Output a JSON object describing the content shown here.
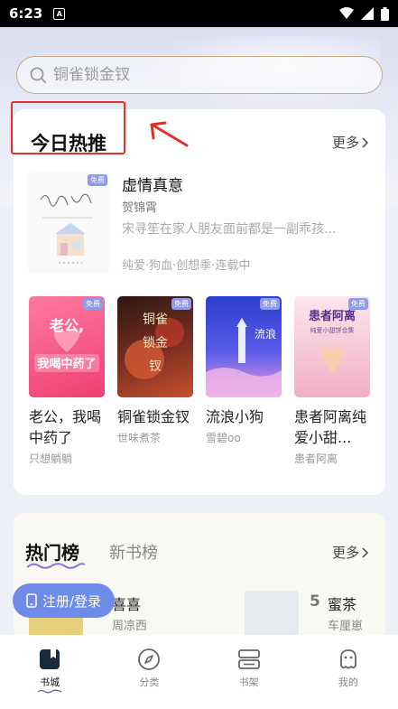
{
  "status_bar": {
    "time": "6:23",
    "notification_icon": "A"
  },
  "search": {
    "placeholder": "铜雀锁金钗"
  },
  "recommend": {
    "title": "今日热推",
    "more_label": "更多",
    "featured": {
      "badge": "免费",
      "title": "虚情真意",
      "author": "贺锦霄",
      "description": "宋寻笙在家人朋友面前都是一副乖孩...",
      "tags": "纯爱·狗血·创想季·连载中"
    },
    "books": [
      {
        "title": "老公，我喝中药了",
        "author": "只想躺躺",
        "badge": "免费",
        "cover_text": "老公，我喝中药了",
        "cover_color": "#f25a86"
      },
      {
        "title": "铜雀锁金钗",
        "author": "世味煮茶",
        "badge": "免费",
        "cover_text": "铜雀锁金钗",
        "cover_color": "#4a2a22"
      },
      {
        "title": "流浪小狗",
        "author": "雪碧oo",
        "badge": "免费",
        "cover_text": "流浪小狗",
        "cover_color": "#3b4fd6"
      },
      {
        "title": "患者阿离纯爱小甜...",
        "author": "患者阿离",
        "badge": "免费",
        "cover_text": "患者阿离",
        "cover_color": "#f4c6d2"
      }
    ]
  },
  "ranking": {
    "tab_hot": "热门榜",
    "tab_new": "新书榜",
    "more_label": "更多",
    "items": [
      {
        "title": "喜喜",
        "author": "周凉西"
      },
      {
        "rank": "5",
        "title": "蜜茶",
        "author": "车厘崽"
      }
    ]
  },
  "register_button": "注册/登录",
  "bottom_nav": [
    {
      "label": "书城",
      "icon": "bookstore-icon",
      "active": true
    },
    {
      "label": "分类",
      "icon": "compass-icon",
      "active": false
    },
    {
      "label": "书架",
      "icon": "bookshelf-icon",
      "active": false
    },
    {
      "label": "我的",
      "icon": "profile-icon",
      "active": false
    }
  ],
  "colors": {
    "accent": "#6f8bea",
    "highlight": "#e0312b",
    "search_border": "#c9a98a"
  }
}
